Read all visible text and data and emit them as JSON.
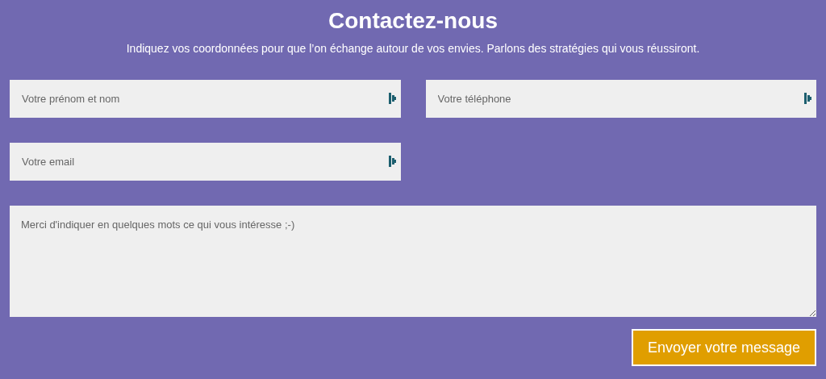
{
  "title": "Contactez-nous",
  "subtitle": "Indiquez vos coordonnées pour que l’on échange autour de vos envies. Parlons des stratégies qui vous réussiront.",
  "fields": [
    {
      "placeholder": "Votre prénom et nom"
    },
    {
      "placeholder": "Votre téléphone"
    },
    {
      "placeholder": "Votre email"
    }
  ],
  "message": {
    "placeholder": "Merci d'indiquer en quelques mots ce qui vous intéresse ;-)"
  },
  "submit": "Envoyer votre message"
}
